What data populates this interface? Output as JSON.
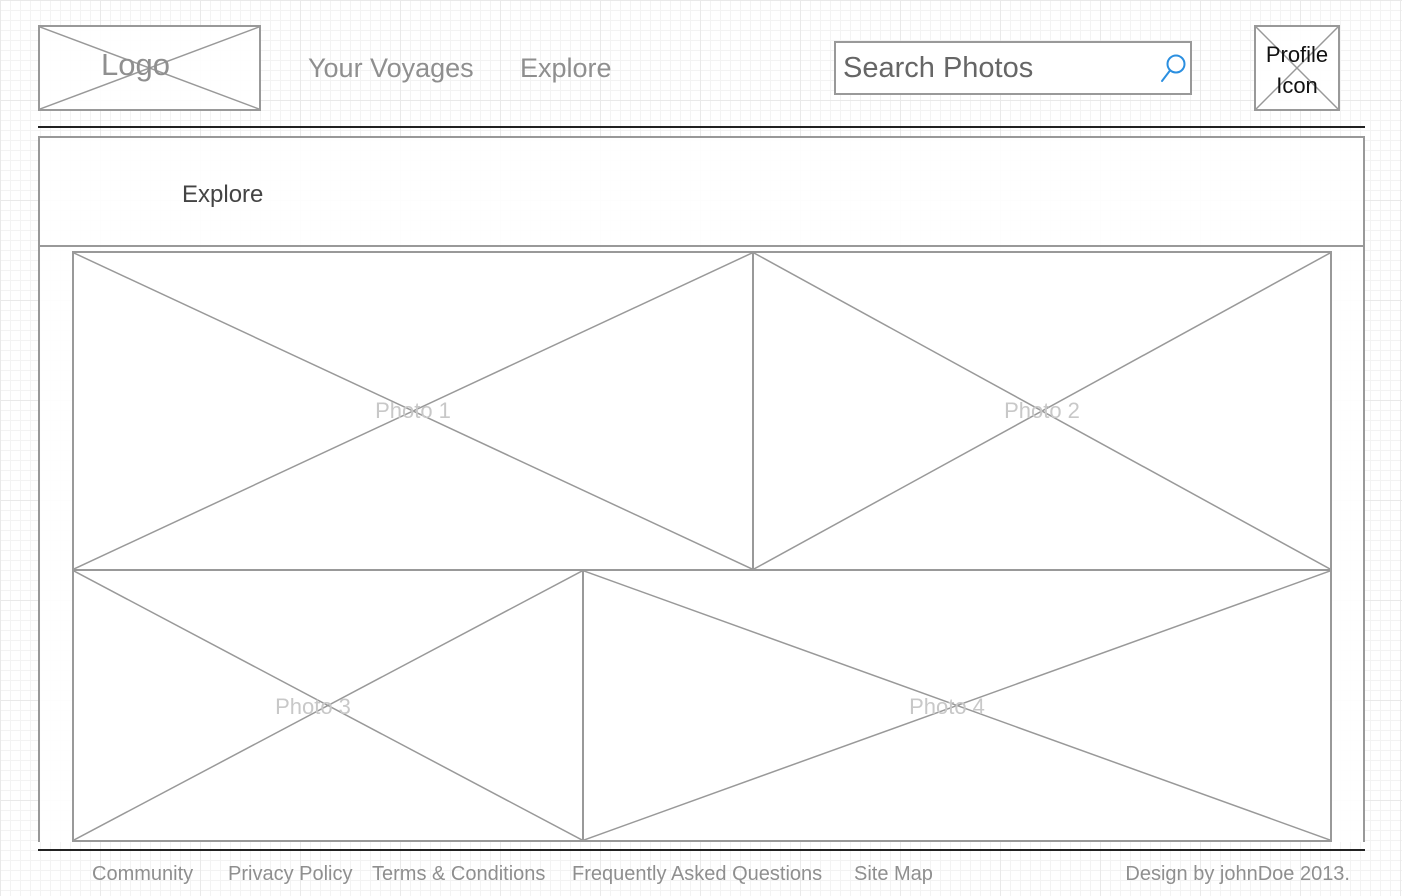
{
  "header": {
    "logo_label": "Logo",
    "nav": [
      {
        "label": "Your Voyages"
      },
      {
        "label": "Explore"
      }
    ],
    "search": {
      "placeholder": "Search Photos",
      "icon": "search-icon",
      "icon_color": "#2b8fe0"
    },
    "profile": {
      "label_line1": "Profile",
      "label_line2": "Icon"
    }
  },
  "banner": {
    "title": "Explore"
  },
  "gallery": {
    "photos": [
      {
        "label": "Photo 1"
      },
      {
        "label": "Photo 2"
      },
      {
        "label": "Photo 3"
      },
      {
        "label": "Photo 4"
      }
    ]
  },
  "footer": {
    "links": [
      {
        "label": "Community"
      },
      {
        "label": "Privacy Policy"
      },
      {
        "label": "Terms & Conditions"
      },
      {
        "label": "Frequently Asked Questions"
      },
      {
        "label": "Site Map"
      }
    ],
    "credit": "Design by johnDoe 2013."
  },
  "colors": {
    "wire_gray": "#999999",
    "text_gray": "#8f8f8f",
    "placeholder_text": "#c8c8c8",
    "rule_dark": "#222222"
  }
}
